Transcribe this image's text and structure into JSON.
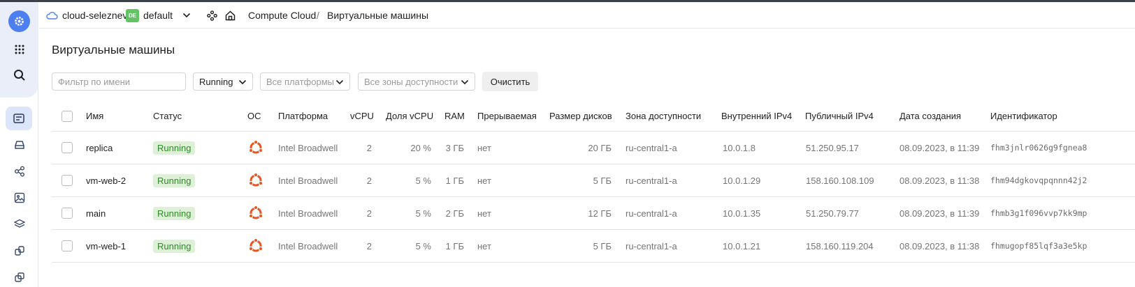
{
  "header": {
    "cloud_name": "cloud-seleznev",
    "folder_badge": "DE",
    "folder_name": "default",
    "breadcrumb_service": "Compute Cloud",
    "breadcrumb_separator": "/",
    "breadcrumb_page": "Виртуальные машины"
  },
  "page": {
    "title": "Виртуальные машины"
  },
  "filters": {
    "name_placeholder": "Фильтр по имени",
    "status_value": "Running",
    "platforms_placeholder": "Все платформы",
    "zones_placeholder": "Все зоны доступности",
    "clear_label": "Очистить"
  },
  "table": {
    "columns": {
      "name": "Имя",
      "status": "Статус",
      "os": "ОС",
      "platform": "Платформа",
      "vcpu": "vCPU",
      "vcpu_share": "Доля vCPU",
      "ram": "RAM",
      "preemptible": "Прерываемая",
      "disk_size": "Размер дисков",
      "zone": "Зона доступности",
      "internal_ip": "Внутренний IPv4",
      "public_ip": "Публичный IPv4",
      "created": "Дата создания",
      "id": "Идентификатор"
    },
    "rows": [
      {
        "name": "replica",
        "status": "Running",
        "os_icon": "ubuntu-icon",
        "platform": "Intel Broadwell",
        "vcpu": "2",
        "vcpu_share": "20 %",
        "ram": "3 ГБ",
        "preemptible": "нет",
        "disk_size": "20 ГБ",
        "zone": "ru-central1-a",
        "internal_ip": "10.0.1.8",
        "public_ip": "51.250.95.17",
        "created": "08.09.2023, в 11:39",
        "id": "fhm3jnlr0626g9fgnea8"
      },
      {
        "name": "vm-web-2",
        "status": "Running",
        "os_icon": "ubuntu-icon",
        "platform": "Intel Broadwell",
        "vcpu": "2",
        "vcpu_share": "5 %",
        "ram": "1 ГБ",
        "preemptible": "нет",
        "disk_size": "5 ГБ",
        "zone": "ru-central1-a",
        "internal_ip": "10.0.1.29",
        "public_ip": "158.160.108.109",
        "created": "08.09.2023, в 11:38",
        "id": "fhm94dgkovqpqnnn42j2"
      },
      {
        "name": "main",
        "status": "Running",
        "os_icon": "ubuntu-icon",
        "platform": "Intel Broadwell",
        "vcpu": "2",
        "vcpu_share": "5 %",
        "ram": "2 ГБ",
        "preemptible": "нет",
        "disk_size": "12 ГБ",
        "zone": "ru-central1-a",
        "internal_ip": "10.0.1.35",
        "public_ip": "51.250.79.77",
        "created": "08.09.2023, в 11:39",
        "id": "fhmb3g1f096vvp7kk9mp"
      },
      {
        "name": "vm-web-1",
        "status": "Running",
        "os_icon": "ubuntu-icon",
        "platform": "Intel Broadwell",
        "vcpu": "2",
        "vcpu_share": "5 %",
        "ram": "1 ГБ",
        "preemptible": "нет",
        "disk_size": "5 ГБ",
        "zone": "ru-central1-a",
        "internal_ip": "10.0.1.21",
        "public_ip": "158.160.119.204",
        "created": "08.09.2023, в 11:38",
        "id": "fhmugopf85lqf3a3e5kp"
      }
    ]
  },
  "colors": {
    "accent": "#4d7ff0",
    "status_bg": "#def1d8",
    "status_text": "#2e8a26",
    "ubuntu": "#e95420",
    "folder_badge": "#62c462"
  }
}
